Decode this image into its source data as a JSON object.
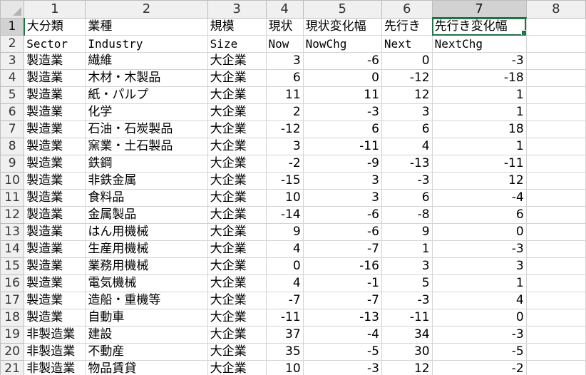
{
  "column_headers": [
    "1",
    "2",
    "3",
    "4",
    "5",
    "6",
    "7",
    "8"
  ],
  "selected_column": 6,
  "selected_row": 0,
  "rows": [
    {
      "num": "1",
      "cells": [
        "大分類",
        "業種",
        "規模",
        "現状",
        "現状変化幅",
        "先行き",
        "先行き変化幅",
        ""
      ]
    },
    {
      "num": "2",
      "cells": [
        "Sector",
        "Industry",
        "Size",
        "Now",
        "NowChg",
        "Next",
        "NextChg",
        ""
      ]
    },
    {
      "num": "3",
      "cells": [
        "製造業",
        "繊維",
        "大企業",
        "3",
        "-6",
        "0",
        "-3",
        ""
      ]
    },
    {
      "num": "4",
      "cells": [
        "製造業",
        "木材・木製品",
        "大企業",
        "6",
        "0",
        "-12",
        "-18",
        ""
      ]
    },
    {
      "num": "5",
      "cells": [
        "製造業",
        "紙・パルプ",
        "大企業",
        "11",
        "11",
        "12",
        "1",
        ""
      ]
    },
    {
      "num": "6",
      "cells": [
        "製造業",
        "化学",
        "大企業",
        "2",
        "-3",
        "3",
        "1",
        ""
      ]
    },
    {
      "num": "7",
      "cells": [
        "製造業",
        "石油・石炭製品",
        "大企業",
        "-12",
        "6",
        "6",
        "18",
        ""
      ]
    },
    {
      "num": "8",
      "cells": [
        "製造業",
        "窯業・土石製品",
        "大企業",
        "3",
        "-11",
        "4",
        "1",
        ""
      ]
    },
    {
      "num": "9",
      "cells": [
        "製造業",
        "鉄鋼",
        "大企業",
        "-2",
        "-9",
        "-13",
        "-11",
        ""
      ]
    },
    {
      "num": "10",
      "cells": [
        "製造業",
        "非鉄金属",
        "大企業",
        "-15",
        "3",
        "-3",
        "12",
        ""
      ]
    },
    {
      "num": "11",
      "cells": [
        "製造業",
        "食料品",
        "大企業",
        "10",
        "3",
        "6",
        "-4",
        ""
      ]
    },
    {
      "num": "12",
      "cells": [
        "製造業",
        "金属製品",
        "大企業",
        "-14",
        "-6",
        "-8",
        "6",
        ""
      ]
    },
    {
      "num": "13",
      "cells": [
        "製造業",
        "はん用機械",
        "大企業",
        "9",
        "-6",
        "9",
        "0",
        ""
      ]
    },
    {
      "num": "14",
      "cells": [
        "製造業",
        "生産用機械",
        "大企業",
        "4",
        "-7",
        "1",
        "-3",
        ""
      ]
    },
    {
      "num": "15",
      "cells": [
        "製造業",
        "業務用機械",
        "大企業",
        "0",
        "-16",
        "3",
        "3",
        ""
      ]
    },
    {
      "num": "16",
      "cells": [
        "製造業",
        "電気機械",
        "大企業",
        "4",
        "-1",
        "5",
        "1",
        ""
      ]
    },
    {
      "num": "17",
      "cells": [
        "製造業",
        "造船・重機等",
        "大企業",
        "-7",
        "-7",
        "-3",
        "4",
        ""
      ]
    },
    {
      "num": "18",
      "cells": [
        "製造業",
        "自動車",
        "大企業",
        "-11",
        "-13",
        "-11",
        "0",
        ""
      ]
    },
    {
      "num": "19",
      "cells": [
        "非製造業",
        "建設",
        "大企業",
        "37",
        "-4",
        "34",
        "-3",
        ""
      ]
    },
    {
      "num": "20",
      "cells": [
        "非製造業",
        "不動産",
        "大企業",
        "35",
        "-5",
        "30",
        "-5",
        ""
      ]
    },
    {
      "num": "21",
      "cells": [
        "非製造業",
        "物品賃貸",
        "大企業",
        "10",
        "-3",
        "12",
        "-2",
        ""
      ]
    }
  ]
}
